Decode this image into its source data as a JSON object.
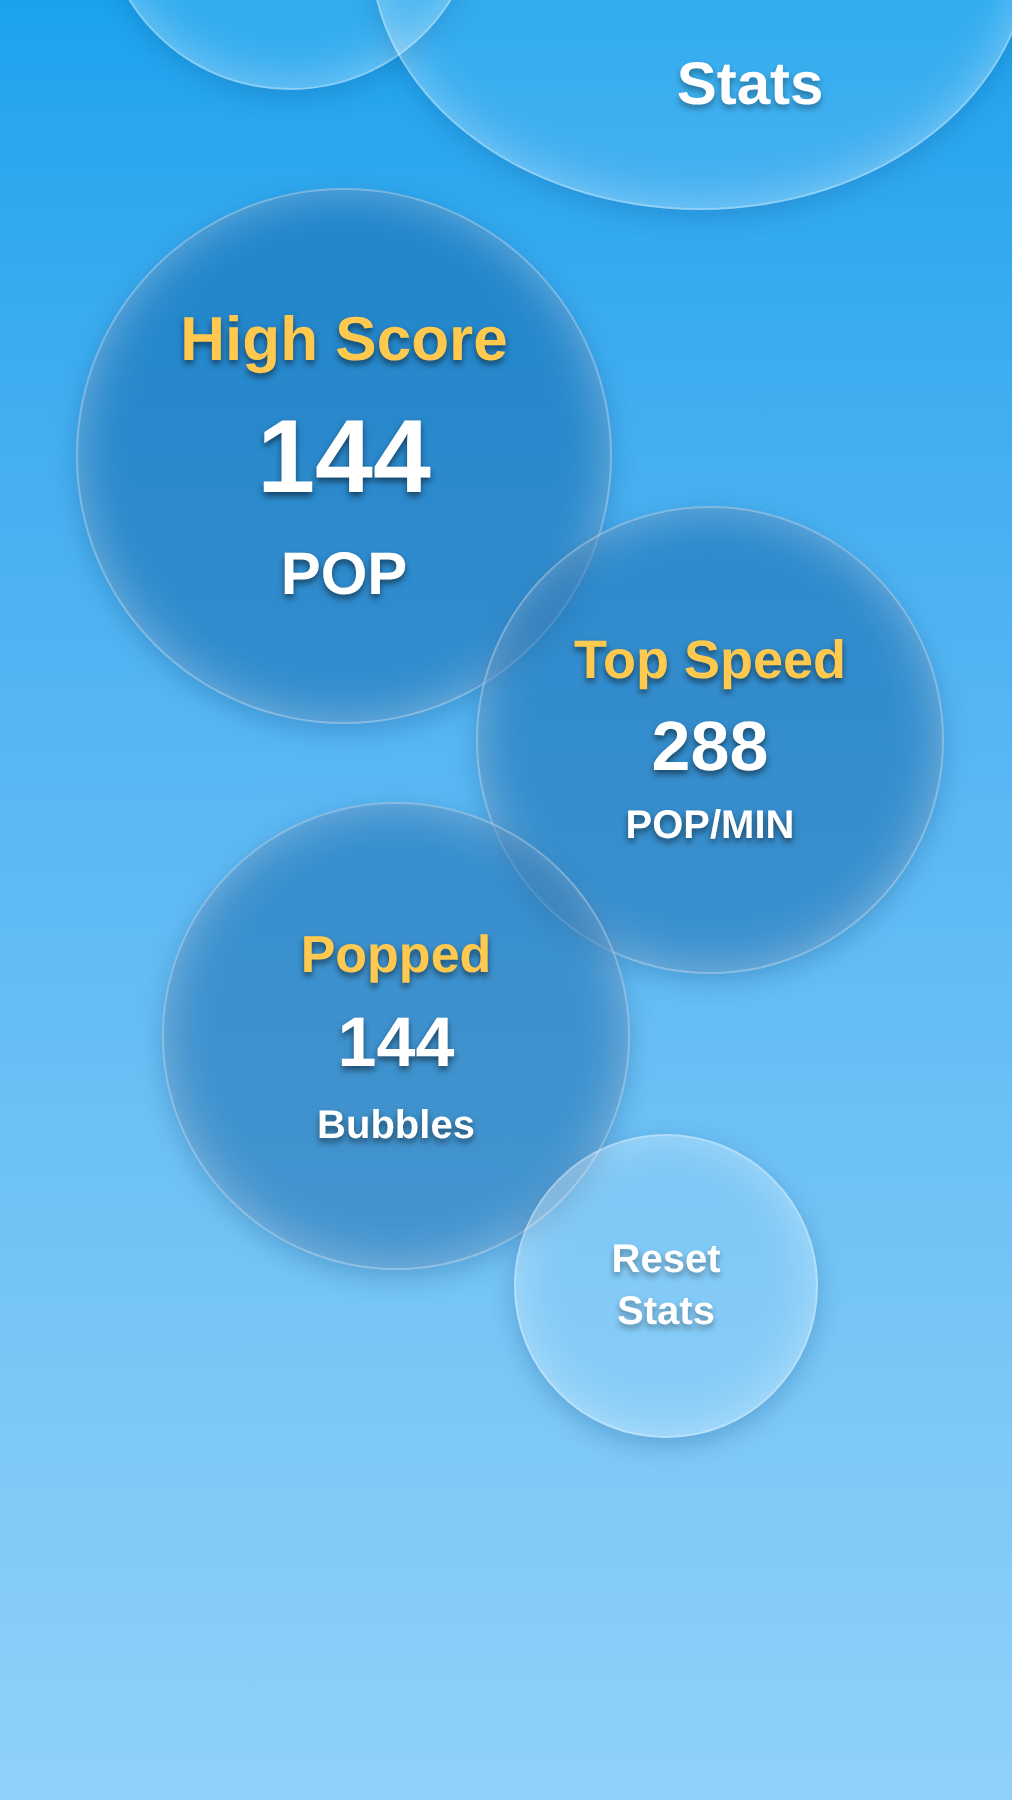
{
  "title": "Stats",
  "stats": [
    {
      "label": "High Score",
      "value": "144",
      "unit": "POP"
    },
    {
      "label": "Top Speed",
      "value": "288",
      "unit": "POP/MIN"
    },
    {
      "label": "Popped",
      "value": "144",
      "unit": "Bubbles"
    }
  ],
  "reset_button": {
    "label": "Reset Stats"
  }
}
